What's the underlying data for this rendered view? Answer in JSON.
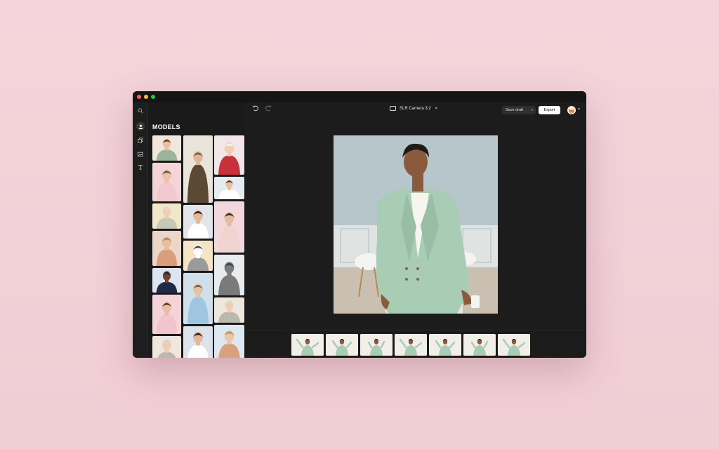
{
  "window": {
    "title": ""
  },
  "sidebar": {
    "title": "MODELS",
    "rail_icons": [
      "search-icon",
      "person-icon",
      "layers-icon",
      "image-icon",
      "text-icon"
    ]
  },
  "toolbar": {
    "undo_icon": "undo-icon",
    "redo_icon": "redo-icon",
    "camera_label": "SLR Camera 3:2",
    "save_label": "Save draft",
    "export_label": "Export"
  },
  "colors": {
    "suit": "#a9cdb4",
    "wall": "#b9c8cc",
    "skin": "#8a5a3c",
    "accent_export": "#ffffff"
  },
  "models": [
    {
      "bg": "#f1e7dc",
      "shirt": "#9bb59a",
      "skin": "#e7c1a3",
      "hair": "#5a3d2a"
    },
    {
      "bg": "#f3d4d9",
      "shirt": "#f0c8cd",
      "skin": "#eac2a6",
      "hair": "#7a5134"
    },
    {
      "bg": "#f1e8c8",
      "shirt": "#c9c7b6",
      "skin": "#f0cdb0",
      "hair": "#dddddd"
    },
    {
      "bg": "#ecd6c7",
      "shirt": "#d99f7a",
      "skin": "#e6bfa1",
      "hair": "#b8874d"
    },
    {
      "bg": "#dbe6f2",
      "shirt": "#1f2a44",
      "skin": "#6b4330",
      "hair": "#222222"
    },
    {
      "bg": "#f4d4d8",
      "shirt": "#f2c4cb",
      "skin": "#e8bea3",
      "hair": "#5b3a28"
    },
    {
      "bg": "#efe6dc",
      "shirt": "#b9b9b0",
      "skin": "#efcdb1",
      "hair": "#d8d8d8"
    },
    {
      "bg": "#e8e4d9",
      "shirt": "#5a4a35",
      "skin": "#e1b697",
      "hair": "#6f5a45"
    },
    {
      "bg": "#e2e6ea",
      "shirt": "#ffffff",
      "skin": "#e3b899",
      "hair": "#2d2118"
    },
    {
      "bg": "#f5e4c6",
      "shirt": "#9a9a9a",
      "skin": "#ffffff",
      "hair": "#444444"
    },
    {
      "bg": "#cfe0ea",
      "shirt": "#9fc6e0",
      "skin": "#e7c1a3",
      "hair": "#8a5a34"
    },
    {
      "bg": "#dce3ea",
      "shirt": "#ffffff",
      "skin": "#e3b899",
      "hair": "#2d2118"
    },
    {
      "bg": "#f3e6e8",
      "shirt": "#c8303a",
      "skin": "#f1cfb6",
      "hair": "#f4f4f4"
    },
    {
      "bg": "#e5ebf0",
      "shirt": "#ffffff",
      "skin": "#e6c0a2",
      "hair": "#3a2a1e"
    },
    {
      "bg": "#f2d8dc",
      "shirt": "#efd4cf",
      "skin": "#e5bca0",
      "hair": "#3b2b1e"
    },
    {
      "bg": "#e9ecef",
      "shirt": "#7a7a7a",
      "skin": "#7a7a7a",
      "hair": "#444444"
    },
    {
      "bg": "#efe6dc",
      "shirt": "#b9b9b0",
      "skin": "#efcdb1",
      "hair": "#d8d8d8"
    },
    {
      "bg": "#dce8f2",
      "shirt": "#d9a27a",
      "skin": "#ecc7a8",
      "hair": "#c28f57"
    }
  ],
  "filmstrip_count": 7
}
